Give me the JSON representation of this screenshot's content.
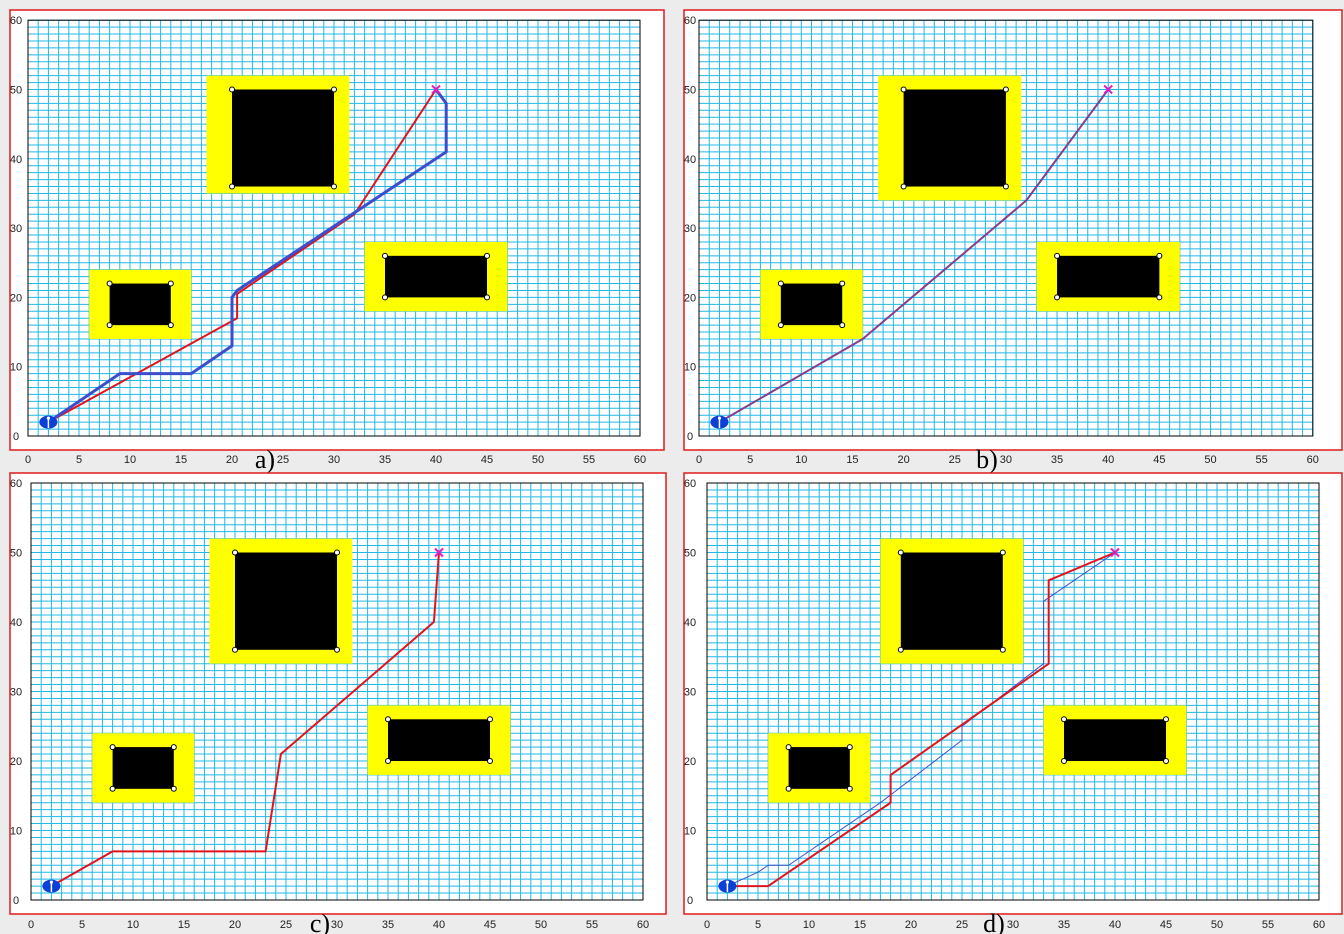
{
  "panels": [
    {
      "id": "a",
      "label": "a)",
      "x_ticks": [
        "0",
        "5",
        "10",
        "15",
        "20",
        "25",
        "30",
        "35",
        "40",
        "45",
        "50",
        "55",
        "60"
      ],
      "y_ticks": [
        "0",
        "10",
        "20",
        "30",
        "40",
        "50",
        "60"
      ],
      "start": {
        "x": 2,
        "y": 2
      },
      "goal": {
        "x": 40,
        "y": 50
      },
      "obstacles": [
        {
          "zone": [
            [
              17.5,
              35
            ],
            [
              31.5,
              52
            ]
          ],
          "core": [
            [
              20,
              36
            ],
            [
              30,
              50
            ]
          ]
        },
        {
          "zone": [
            [
              6,
              14
            ],
            [
              16,
              24
            ]
          ],
          "core": [
            [
              8,
              16
            ],
            [
              14,
              22
            ]
          ]
        },
        {
          "zone": [
            [
              33,
              18
            ],
            [
              47,
              28
            ]
          ],
          "core": [
            [
              35,
              20
            ],
            [
              45,
              26
            ]
          ]
        }
      ],
      "paths": [
        {
          "color": "#e0141e",
          "width": 2,
          "points": [
            [
              2,
              2
            ],
            [
              20.5,
              17
            ],
            [
              20.5,
              20.5
            ],
            [
              32,
              32
            ],
            [
              40,
              50
            ]
          ]
        },
        {
          "color": "#3d4ecc",
          "width": 3,
          "points": [
            [
              2,
              2
            ],
            [
              9,
              9
            ],
            [
              16,
              9
            ],
            [
              20,
              13
            ],
            [
              20,
              20
            ],
            [
              20.5,
              21
            ],
            [
              41,
              41
            ],
            [
              41,
              48
            ],
            [
              40,
              50
            ]
          ]
        }
      ]
    },
    {
      "id": "b",
      "label": "b)",
      "x_ticks": [
        "0",
        "5",
        "10",
        "15",
        "20",
        "25",
        "30",
        "35",
        "40",
        "45",
        "50",
        "55",
        "60"
      ],
      "y_ticks": [
        "0",
        "10",
        "20",
        "30",
        "40",
        "50",
        "60"
      ],
      "start": {
        "x": 2,
        "y": 2
      },
      "goal": {
        "x": 40,
        "y": 50
      },
      "obstacles": [
        {
          "zone": [
            [
              17.5,
              34
            ],
            [
              31.5,
              52
            ]
          ],
          "core": [
            [
              20,
              36
            ],
            [
              30,
              50
            ]
          ]
        },
        {
          "zone": [
            [
              6,
              14
            ],
            [
              16,
              24
            ]
          ],
          "core": [
            [
              8,
              16
            ],
            [
              14,
              22
            ]
          ]
        },
        {
          "zone": [
            [
              33,
              18
            ],
            [
              47,
              28
            ]
          ],
          "core": [
            [
              35,
              20
            ],
            [
              45,
              26
            ]
          ]
        }
      ],
      "paths": [
        {
          "color": "#3d4ecc",
          "width": 2,
          "points": [
            [
              2,
              2
            ],
            [
              16,
              14
            ],
            [
              32,
              34
            ],
            [
              40,
              50
            ]
          ]
        },
        {
          "color": "#c0305a",
          "width": 1,
          "points": [
            [
              2,
              2
            ],
            [
              16,
              14
            ],
            [
              32,
              34
            ],
            [
              40,
              50
            ]
          ]
        }
      ]
    },
    {
      "id": "c",
      "label": "c)",
      "x_ticks": [
        "0",
        "5",
        "10",
        "15",
        "20",
        "25",
        "30",
        "35",
        "40",
        "45",
        "50",
        "55",
        "60"
      ],
      "y_ticks": [
        "0",
        "10",
        "20",
        "30",
        "40",
        "50",
        "60"
      ],
      "start": {
        "x": 2,
        "y": 2
      },
      "goal": {
        "x": 40,
        "y": 50
      },
      "obstacles": [
        {
          "zone": [
            [
              17.5,
              34
            ],
            [
              31.5,
              52
            ]
          ],
          "core": [
            [
              20,
              36
            ],
            [
              30,
              50
            ]
          ]
        },
        {
          "zone": [
            [
              6,
              14
            ],
            [
              16,
              24
            ]
          ],
          "core": [
            [
              8,
              16
            ],
            [
              14,
              22
            ]
          ]
        },
        {
          "zone": [
            [
              33,
              18
            ],
            [
              47,
              28
            ]
          ],
          "core": [
            [
              35,
              20
            ],
            [
              45,
              26
            ]
          ]
        }
      ],
      "paths": [
        {
          "color": "#e0141e",
          "width": 2,
          "points": [
            [
              2,
              2
            ],
            [
              8,
              7
            ],
            [
              23,
              7
            ],
            [
              24.5,
              21
            ],
            [
              39.5,
              40
            ],
            [
              40,
              50
            ]
          ]
        }
      ]
    },
    {
      "id": "d",
      "label": "d)",
      "x_ticks": [
        "0",
        "5",
        "10",
        "15",
        "20",
        "25",
        "30",
        "35",
        "40",
        "45",
        "50",
        "55",
        "60"
      ],
      "y_ticks": [
        "0",
        "10",
        "20",
        "30",
        "40",
        "50",
        "60"
      ],
      "start": {
        "x": 2,
        "y": 2
      },
      "goal": {
        "x": 40,
        "y": 50
      },
      "obstacles": [
        {
          "zone": [
            [
              17,
              34
            ],
            [
              31,
              52
            ]
          ],
          "core": [
            [
              19,
              36
            ],
            [
              29,
              50
            ]
          ]
        },
        {
          "zone": [
            [
              6,
              14
            ],
            [
              16,
              24
            ]
          ],
          "core": [
            [
              8,
              16
            ],
            [
              14,
              22
            ]
          ]
        },
        {
          "zone": [
            [
              33,
              18
            ],
            [
              47,
              28
            ]
          ],
          "core": [
            [
              35,
              20
            ],
            [
              45,
              26
            ]
          ]
        }
      ],
      "paths": [
        {
          "color": "#3d4ecc",
          "width": 1,
          "points": [
            [
              2,
              2
            ],
            [
              5,
              4
            ],
            [
              6,
              5
            ],
            [
              8,
              5
            ],
            [
              17,
              14
            ],
            [
              25,
              23
            ],
            [
              25,
              25
            ],
            [
              33,
              34
            ],
            [
              33,
              43
            ],
            [
              40,
              50
            ]
          ]
        },
        {
          "color": "#e0141e",
          "width": 2,
          "points": [
            [
              2,
              2
            ],
            [
              6,
              2
            ],
            [
              18,
              14
            ],
            [
              18,
              18
            ],
            [
              33.5,
              34
            ],
            [
              33.5,
              46
            ],
            [
              40,
              50
            ]
          ]
        }
      ]
    }
  ]
}
